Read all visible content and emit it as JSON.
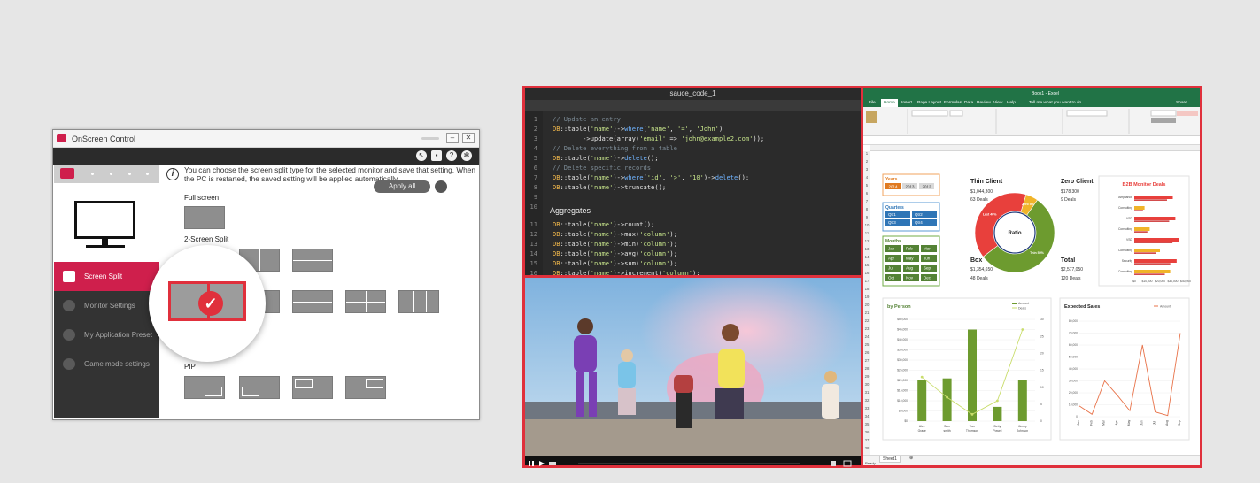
{
  "osc": {
    "title": "OnScreen Control",
    "sidebar": [
      {
        "label": "Screen Split",
        "icon": "screen-split-icon",
        "active": true
      },
      {
        "label": "Monitor Settings",
        "icon": "monitor-settings-icon",
        "active": false
      },
      {
        "label": "My Application Preset",
        "icon": "application-preset-icon",
        "active": false
      },
      {
        "label": "Game mode settings",
        "icon": "gamepad-icon",
        "active": false
      }
    ],
    "description": "You can choose the screen split type for the selected monitor and save that setting. When the PC is restarted, the saved setting will be applied automatically.",
    "apply_all": "Apply all",
    "sections": {
      "full": "Full screen",
      "two": "2-Screen Split",
      "pip": "PIP"
    }
  },
  "code": {
    "window_title": "sauce_code_1",
    "aggregates_heading": "Aggregates"
  },
  "excel": {
    "tabs": [
      "File",
      "Home",
      "Insert",
      "Page Layout",
      "Formulas",
      "Data",
      "Review",
      "View",
      "Help"
    ],
    "tell_me": "Tell me what you want to do",
    "share": "Share",
    "workbook": "Book1 - Excel",
    "sheet_tab": "Sheet1",
    "status": "Ready",
    "years_title": "Years",
    "years": [
      "2014",
      "2013",
      "2012"
    ],
    "quarters_title": "Quarters",
    "quarters": [
      "Qtr1",
      "Qtr2",
      "Qtr3",
      "Qtr4"
    ],
    "months_title": "Months",
    "months": [
      "Jan",
      "Feb",
      "Mar",
      "Apr",
      "May",
      "Jun",
      "Jul",
      "Aug",
      "Sep",
      "Oct",
      "Nov",
      "Dec"
    ],
    "ratio_label": "Ratio",
    "thin_client": {
      "label": "Thin Client",
      "amount": "$1,044,300",
      "deals": "63 Deals"
    },
    "zero_client": {
      "label": "Zero Client",
      "amount": "$178,300",
      "deals": "9 Deals"
    },
    "box": {
      "label": "Box",
      "amount": "$1,354,650",
      "deals": "48 Deals"
    },
    "total": {
      "label": "Total",
      "amount": "$2,577,050",
      "deals": "120 Deals"
    },
    "b2b_title": "B2B Monitor Deals",
    "by_person_title": "by Person",
    "expected_title": "Expected Sales"
  },
  "chart_data": [
    {
      "type": "pie",
      "title": "Ratio",
      "categories": [
        "Thin",
        "Last",
        "Zero"
      ],
      "values": [
        55,
        40,
        5
      ],
      "colors": [
        "#6d9b2f",
        "#e8403c",
        "#f0b429"
      ],
      "labels": [
        "Thin 55%",
        "Last 40%",
        "Zero 5%"
      ]
    },
    {
      "type": "bar",
      "title": "B2B Monitor Deals",
      "categories": [
        "Ampliance",
        "Consulting",
        "VSD",
        "Consulting",
        "VSD",
        "Consulting",
        "Security",
        "Consulting"
      ],
      "series": [
        {
          "values": [
            30000,
            8000,
            32000,
            12000,
            35000,
            20000,
            33000,
            28000
          ]
        }
      ],
      "xticks": [
        "$0",
        "$10,000",
        "$20,000",
        "$30,000",
        "$40,000"
      ],
      "xlim": [
        0,
        40000
      ]
    },
    {
      "type": "bar",
      "title": "by Person",
      "categories": [
        "Alex Grace",
        "Sam smith",
        "Tom Thomson",
        "Betty Powell",
        "Jimmy Johnson"
      ],
      "series": [
        {
          "name": "Amount",
          "values": [
            20000,
            21000,
            45000,
            7000,
            20000
          ]
        },
        {
          "name": "Deals",
          "values": [
            13,
            7,
            2,
            6,
            27
          ]
        }
      ],
      "ylim": [
        0,
        50000
      ],
      "yticks": [
        "$0",
        "$5,000",
        "$10,000",
        "$15,000",
        "$20,000",
        "$25,000",
        "$30,000",
        "$35,000",
        "$40,000",
        "$45,000",
        "$50,000"
      ],
      "y2ticks": [
        "0",
        "5",
        "10",
        "15",
        "20",
        "25",
        "30"
      ]
    },
    {
      "type": "line",
      "title": "Expected Sales",
      "categories": [
        "Jan",
        "Feb",
        "Mar",
        "Apr",
        "May",
        "Jun",
        "Jul",
        "Aug",
        "Sep"
      ],
      "series": [
        {
          "name": "Amount",
          "values": [
            9000,
            2000,
            30000,
            18000,
            5000,
            60000,
            4000,
            1000,
            70000
          ]
        }
      ],
      "ylim": [
        0,
        80000
      ],
      "yticks": [
        "0",
        "10,000",
        "20,000",
        "30,000",
        "40,000",
        "50,000",
        "60,000",
        "70,000",
        "80,000"
      ]
    }
  ]
}
